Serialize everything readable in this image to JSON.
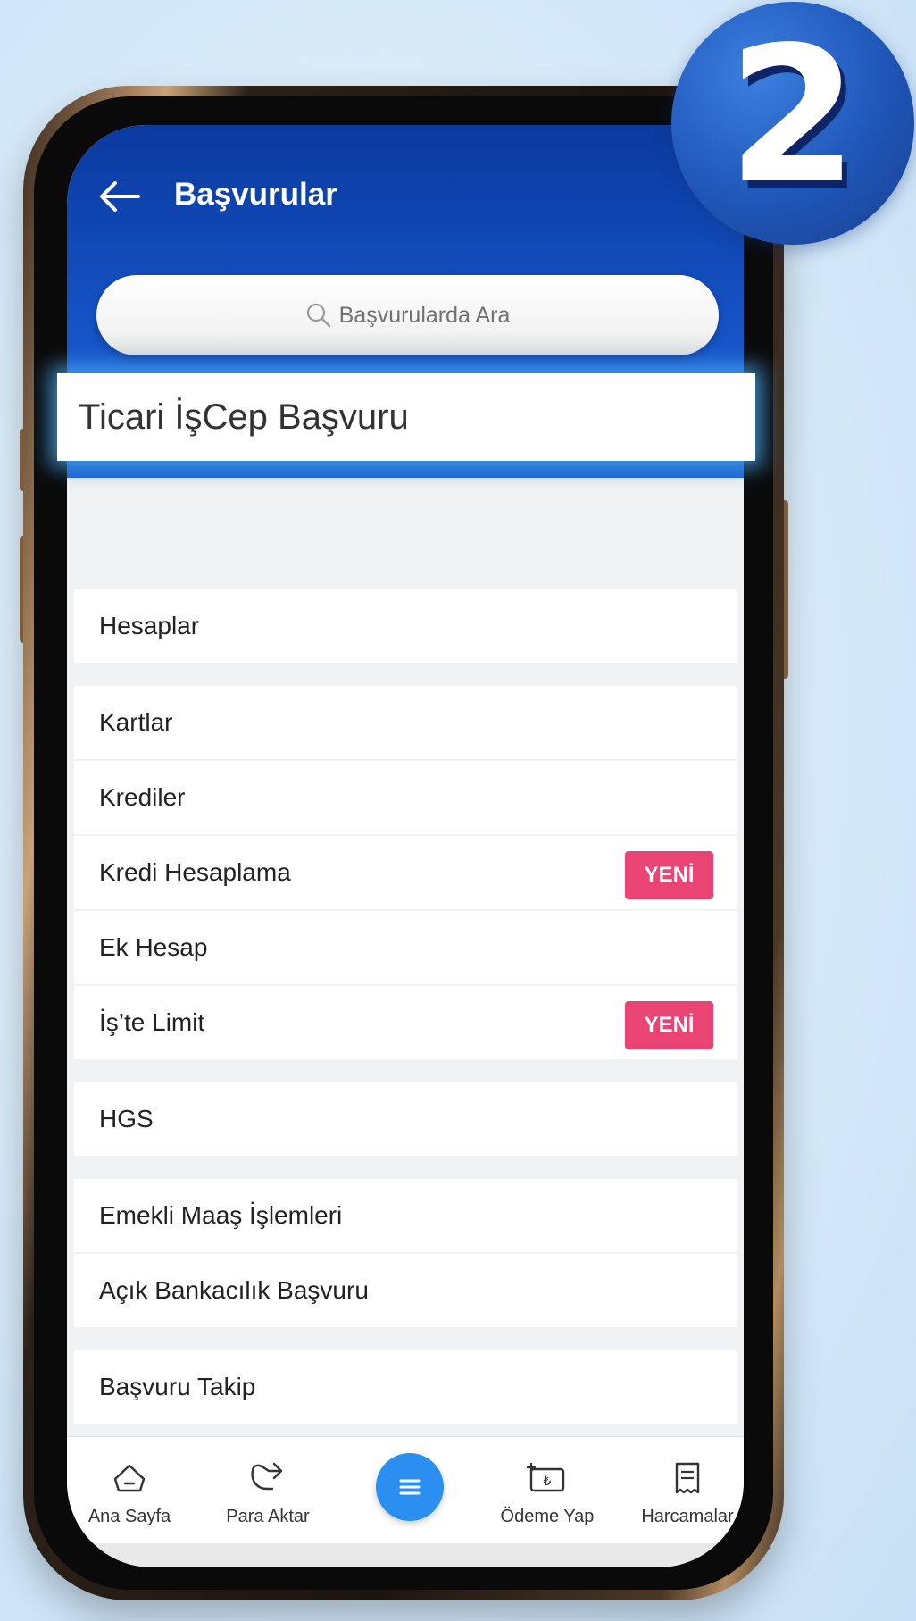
{
  "step_badge": "2",
  "header": {
    "title": "Başvurular"
  },
  "search": {
    "placeholder": "Başvurularda Ara"
  },
  "highlight": {
    "label": "Ticari İşCep Başvuru"
  },
  "menu": [
    {
      "label": "Hesaplar"
    },
    {
      "label": "Kartlar"
    },
    {
      "label": "Krediler"
    },
    {
      "label": "Kredi Hesaplama",
      "badge": "YENİ"
    },
    {
      "label": "Ek Hesap"
    },
    {
      "label": "İş’te Limit",
      "badge": "YENİ"
    },
    {
      "label": "HGS"
    },
    {
      "label": "Emekli Maaş İşlemleri"
    },
    {
      "label": "Açık Bankacılık Başvuru"
    },
    {
      "label": "Başvuru Takip"
    }
  ],
  "bottom_nav": [
    {
      "label": "Ana Sayfa",
      "icon": "home-icon"
    },
    {
      "label": "Para Aktar",
      "icon": "transfer-icon"
    },
    {
      "label": "",
      "icon": "menu-icon"
    },
    {
      "label": "Ödeme Yap",
      "icon": "payment-icon"
    },
    {
      "label": "Harcamalar",
      "icon": "receipt-icon"
    }
  ],
  "colors": {
    "header_blue": "#1552c4",
    "badge_pink": "#ea4475",
    "menu_button_blue": "#2a8ff0"
  }
}
